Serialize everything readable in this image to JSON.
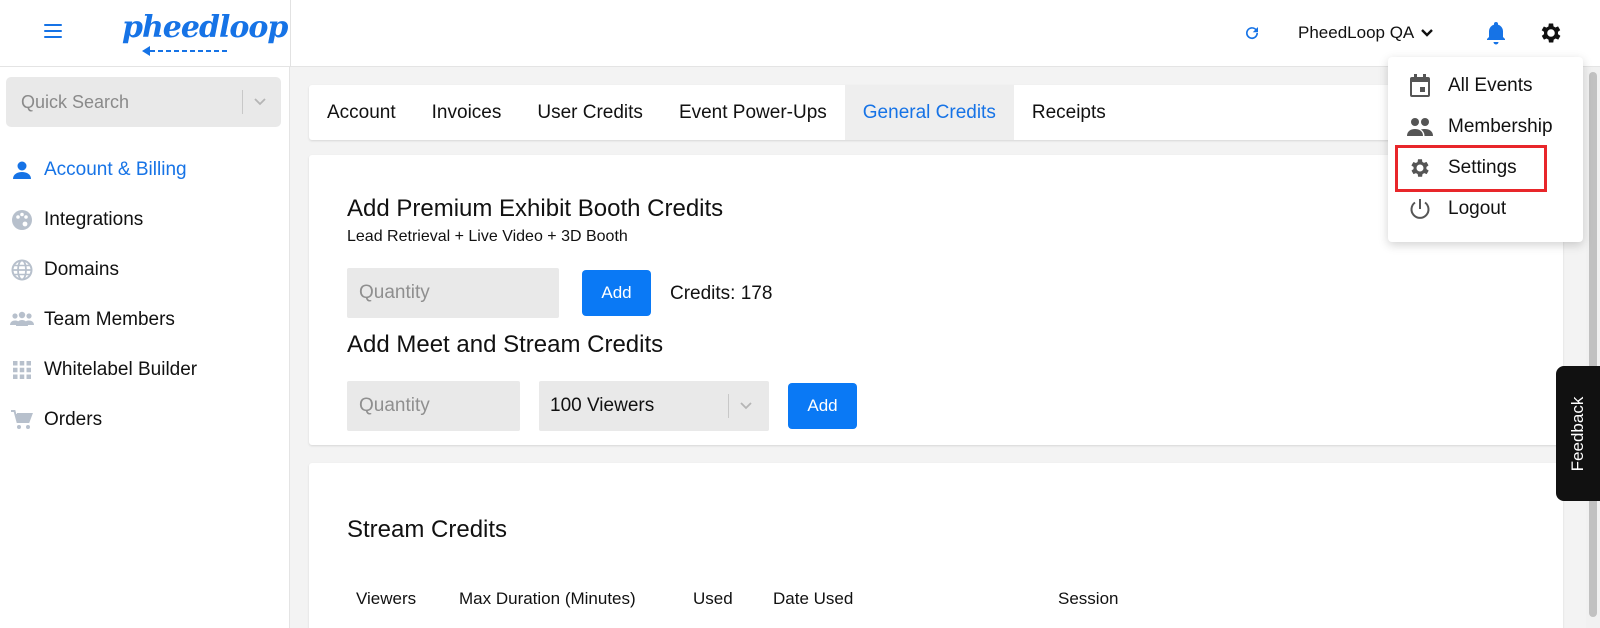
{
  "header": {
    "logo_text": "pheedloop",
    "org_name": "PheedLoop QA"
  },
  "sidebar": {
    "search_placeholder": "Quick Search",
    "items": [
      {
        "label": "Account & Billing",
        "icon": "person-icon",
        "active": true
      },
      {
        "label": "Integrations",
        "icon": "palette-icon",
        "active": false
      },
      {
        "label": "Domains",
        "icon": "globe-icon",
        "active": false
      },
      {
        "label": "Team Members",
        "icon": "group-icon",
        "active": false
      },
      {
        "label": "Whitelabel Builder",
        "icon": "grid-icon",
        "active": false
      },
      {
        "label": "Orders",
        "icon": "cart-icon",
        "active": false
      }
    ]
  },
  "tabs": [
    {
      "label": "Account",
      "active": false
    },
    {
      "label": "Invoices",
      "active": false
    },
    {
      "label": "User Credits",
      "active": false
    },
    {
      "label": "Event Power-Ups",
      "active": false
    },
    {
      "label": "General Credits",
      "active": true
    },
    {
      "label": "Receipts",
      "active": false
    }
  ],
  "premium": {
    "title": "Add Premium Exhibit Booth Credits",
    "subtitle": "Lead Retrieval + Live Video + 3D Booth",
    "quantity_placeholder": "Quantity",
    "add_label": "Add",
    "credits_text": "Credits: 178"
  },
  "meet": {
    "title": "Add Meet and Stream Credits",
    "quantity_placeholder": "Quantity",
    "viewers_selected": "100 Viewers",
    "add_label": "Add"
  },
  "stream": {
    "title": "Stream Credits",
    "columns": [
      "Viewers",
      "Max Duration (Minutes)",
      "Used",
      "Date Used",
      "Session"
    ]
  },
  "menu": {
    "items": [
      {
        "label": "All Events",
        "icon": "calendar-icon"
      },
      {
        "label": "Membership",
        "icon": "people-icon"
      },
      {
        "label": "Settings",
        "icon": "gear-icon"
      },
      {
        "label": "Logout",
        "icon": "power-icon"
      }
    ]
  },
  "feedback_label": "Feedback",
  "colors": {
    "accent": "#1673e6",
    "button": "#0a79f5",
    "highlight": "#e8262a"
  }
}
